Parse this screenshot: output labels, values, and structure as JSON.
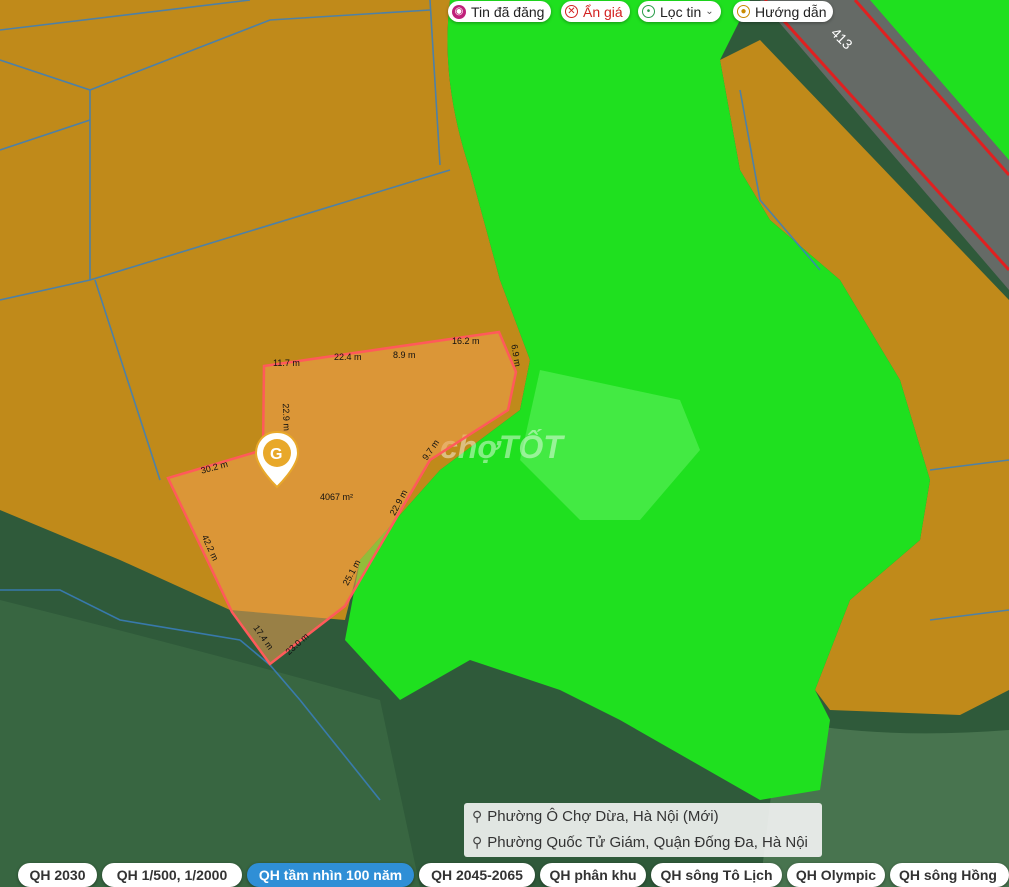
{
  "top_controls": [
    {
      "label": "Tin đã đăng",
      "icon": "listing-icon",
      "color": "#c0207a"
    },
    {
      "label": "Ẩn giá",
      "icon": "close-circle-icon",
      "color": "#d32020"
    },
    {
      "label": "Lọc tin",
      "icon": "map-pin-icon",
      "color": "#2a9d4a"
    },
    {
      "label": "Hướng dẫn",
      "icon": "guide-icon",
      "color": "#c98a00"
    }
  ],
  "road_label": "413",
  "plot": {
    "area": "4067 m²",
    "edge_lengths": [
      "11.7 m",
      "22.4 m",
      "8.9 m",
      "16.2 m",
      "6.9 m",
      "9.7 m",
      "22.9 m",
      "25.1 m",
      "23.0 m",
      "17.4 m",
      "42.2 m",
      "30.2 m",
      "22.9 m"
    ]
  },
  "watermark": "chợTỐT",
  "marker_letter": "G",
  "address": {
    "new": "Phường Ô Chợ Dừa, Hà Nội (Mới)",
    "old": "Phường Quốc Tử Giám, Quận Đống Đa, Hà Nội"
  },
  "plan_tabs": [
    {
      "label": "QH 2030",
      "selected": false
    },
    {
      "label": "QH 1/500, 1/2000",
      "selected": false
    },
    {
      "label": "QH tầm nhìn 100 năm",
      "selected": true
    },
    {
      "label": "QH 2045-2065",
      "selected": false
    },
    {
      "label": "QH phân khu",
      "selected": false
    },
    {
      "label": "QH sông Tô Lịch",
      "selected": false
    },
    {
      "label": "QH Olympic",
      "selected": false
    },
    {
      "label": "QH sông Hồng",
      "selected": false
    }
  ],
  "colors": {
    "residential_zone": "#c08a1a",
    "green_zone": "#1fe01f",
    "forest_base": "#2f5a3a",
    "plot_outline": "#ff5a5a",
    "road_outline": "#e02020",
    "selected_tab": "#2f8fd6"
  }
}
